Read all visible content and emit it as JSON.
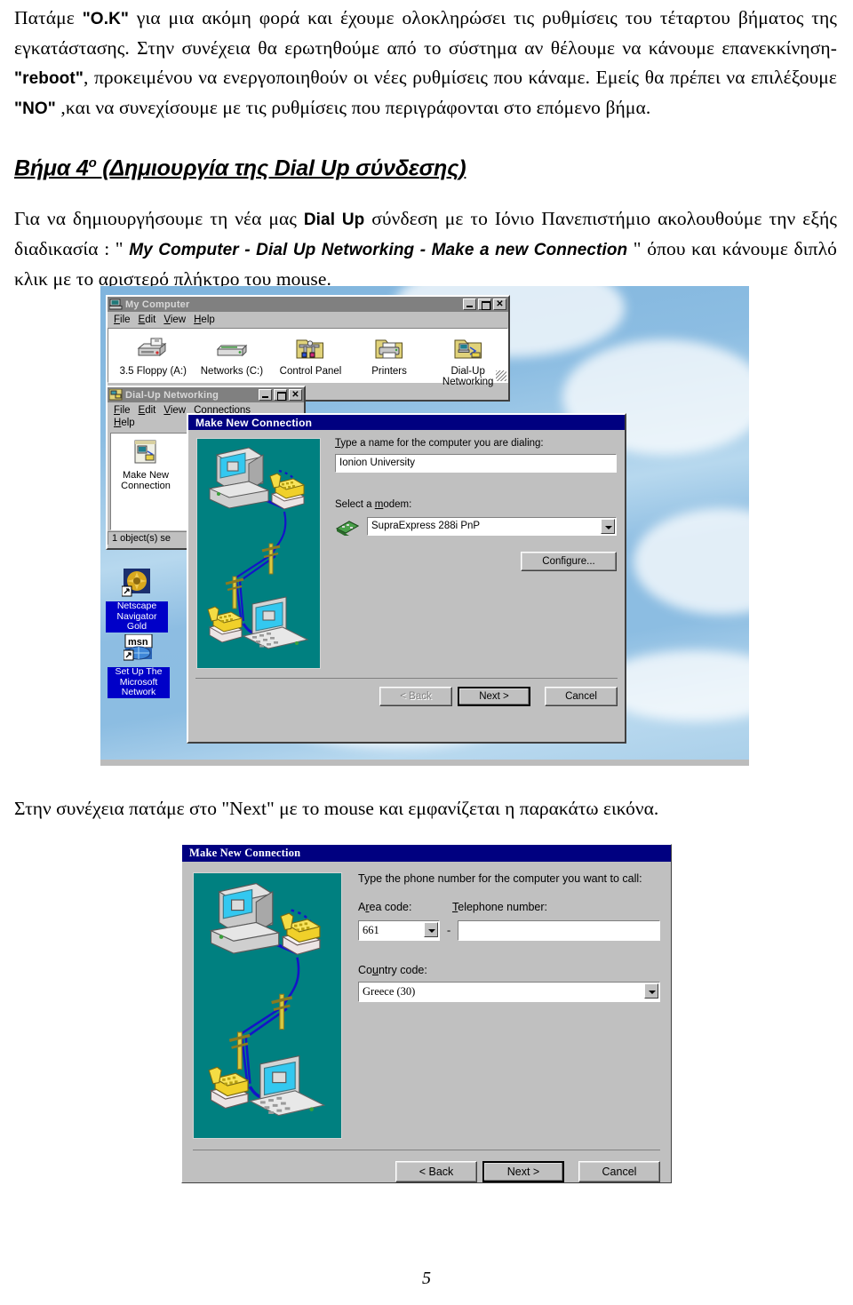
{
  "document": {
    "page_number": "5",
    "paragraph_1": {
      "t1": "Πατάμε ",
      "b1": "\"O.K\"",
      "t2": " για μια ακόμη φορά και έχουμε ολοκληρώσει τις ρυθμίσεις του τέταρτου βήματος της εγκατάστασης. Στην συνέχεια θα ερωτηθούμε από το σύστημα αν θέλουμε να κάνουμε επανεκκίνηση-",
      "b2": "\"reboot\"",
      "t3": ", προκειμένου να ενεργοποιηθούν οι νέες ρυθμίσεις που κάναμε. Εμείς θα πρέπει να επιλέξουμε ",
      "b3": "\"NO\"",
      "t4": " ,και να συνεχίσουμε με τις ρυθμίσεις που περιγράφονται στο επόμενο βήμα."
    },
    "heading": {
      "main": "Βήμα 4",
      "sup": "ο",
      "rest": " (Δημιουργία της Dial Up σύνδεσης)"
    },
    "paragraph_2": {
      "t1": "Για να δημιουργήσουμε τη νέα μας ",
      "b1": "Dial Up",
      "t2": " σύνδεση με το Ιόνιο Πανεπιστήμιο ακολουθούμε την εξής διαδικασία : \" ",
      "b2": "My Computer - Dial Up Networking - Make a new Connection",
      "t3": " \" όπου και κάνουμε διπλό κλικ με το αριστερό πλήκτρο του mouse."
    },
    "caption_1": "Στην συνέχεια πατάμε στο \"Next\" με το mouse και εμφανίζεται η παρακάτω εικόνα."
  },
  "screenshot1": {
    "my_computer_window": {
      "title": "My Computer",
      "title_icon": "computer-icon",
      "menu": [
        "File",
        "Edit",
        "View",
        "Help"
      ],
      "title_buttons": [
        "minimize",
        "maximize",
        "close"
      ],
      "icons": [
        {
          "label": "3.5 Floppy (A:)",
          "icon": "floppy-drive-icon"
        },
        {
          "label": "Networks (C:)",
          "icon": "hard-drive-icon"
        },
        {
          "label": "Control Panel",
          "icon": "control-panel-folder-icon"
        },
        {
          "label": "Printers",
          "icon": "printers-folder-icon"
        },
        {
          "label": "Dial-Up Networking",
          "icon": "dialup-folder-icon"
        }
      ]
    },
    "dialup_window": {
      "title": "Dial-Up Networking",
      "title_icon": "dialup-networking-icon",
      "menu": [
        "File",
        "Edit",
        "View",
        "Connections",
        "Help"
      ],
      "item_label": "Make New Connection",
      "item_icon": "make-new-connection-icon",
      "status": "1 object(s) se"
    },
    "desktop_icons": [
      {
        "label": "Netscape Navigator Gold",
        "icon": "netscape-navigator-icon"
      },
      {
        "label": "Set Up The Microsoft Network",
        "icon": "msn-icon"
      }
    ],
    "wizard": {
      "title": "Make New Connection",
      "name_label": "Type a name for the computer you are dialing:",
      "name_value": "Ionion University",
      "modem_label": "Select a modem:",
      "modem_value": "SupraExpress 288i PnP",
      "modem_icon": "modem-card-icon",
      "configure_button": "Configure...",
      "buttons": {
        "back": "< Back",
        "next": "Next >",
        "cancel": "Cancel",
        "back_disabled": true
      }
    }
  },
  "screenshot2": {
    "wizard": {
      "title": "Make New Connection",
      "instruction": "Type the phone number for the computer you want to call:",
      "area_code_label": "Area code:",
      "area_code_value": "661",
      "separator": "-",
      "telephone_label": "Telephone number:",
      "telephone_value": "",
      "country_label": "Country code:",
      "country_value": "Greece (30)",
      "buttons": {
        "back": "< Back",
        "next": "Next >",
        "cancel": "Cancel",
        "back_disabled": false
      }
    }
  },
  "colors": {
    "titlebar_active": "#000080",
    "titlebar_inactive": "#808080",
    "window_face": "#c0c0c0",
    "wizard_picture_bg": "#008080",
    "desktop_label_bg": "#0000c8"
  }
}
